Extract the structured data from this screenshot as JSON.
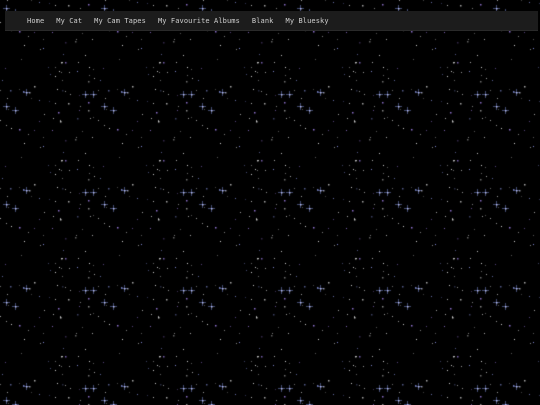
{
  "nav": {
    "items": [
      {
        "label": "Home"
      },
      {
        "label": "My Cat"
      },
      {
        "label": "My Cam Tapes"
      },
      {
        "label": "My Favourite Albums"
      },
      {
        "label": "Blank"
      },
      {
        "label": "My Bluesky"
      }
    ]
  },
  "colors": {
    "background": "#000000",
    "navbar": "#1c1c1c",
    "nav_text": "#cfcfcf",
    "star_white": "#ffffff",
    "star_blue": "#9aa8ff",
    "star_purple": "#b08cff"
  }
}
